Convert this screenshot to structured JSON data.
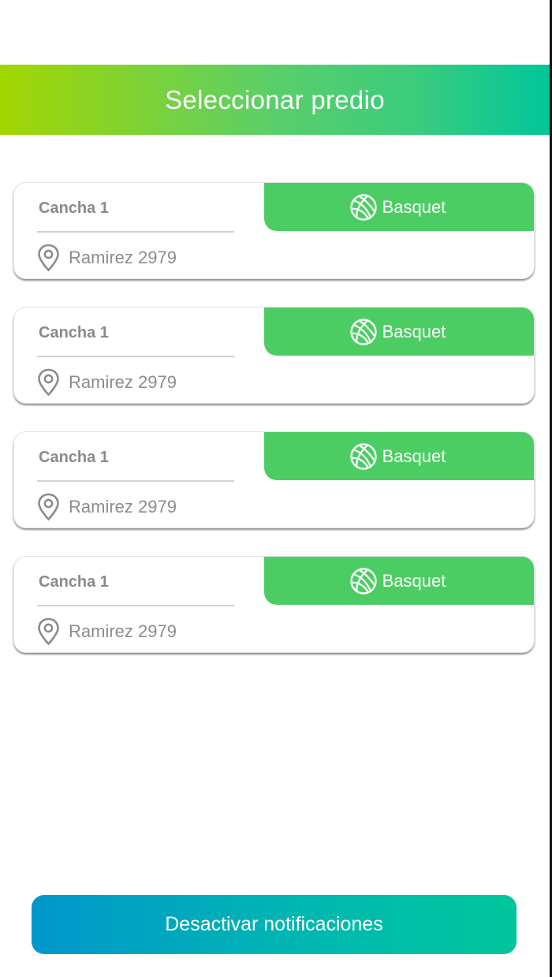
{
  "header": {
    "title": "Seleccionar predio"
  },
  "predios": [
    {
      "name": "Cancha 1",
      "address": "Ramirez 2979",
      "sport": "Basquet",
      "sport_icon": "basketball-icon",
      "location_icon": "map-pin-icon"
    },
    {
      "name": "Cancha 1",
      "address": "Ramirez 2979",
      "sport": "Basquet",
      "sport_icon": "basketball-icon",
      "location_icon": "map-pin-icon"
    },
    {
      "name": "Cancha 1",
      "address": "Ramirez 2979",
      "sport": "Basquet",
      "sport_icon": "basketball-icon",
      "location_icon": "map-pin-icon"
    },
    {
      "name": "Cancha 1",
      "address": "Ramirez 2979",
      "sport": "Basquet",
      "sport_icon": "basketball-icon",
      "location_icon": "map-pin-icon"
    }
  ],
  "footer": {
    "button_label": "Desactivar notificaciones"
  },
  "colors": {
    "header_gradient": [
      "#a3d600",
      "#00c69b"
    ],
    "sport_tab": "#4ccd63",
    "button_gradient": [
      "#0097cb",
      "#00c69b"
    ],
    "text_gray": "#8a8a8a"
  }
}
